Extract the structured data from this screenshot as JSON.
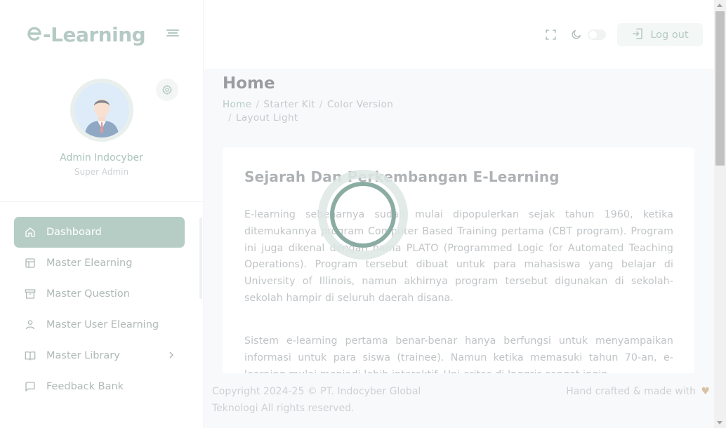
{
  "brand": {
    "logo_text": "-Learning"
  },
  "profile": {
    "name": "Admin Indocyber",
    "role": "Super Admin"
  },
  "sidebar": {
    "items": [
      {
        "label": "Dashboard",
        "icon": "home-icon",
        "active": true
      },
      {
        "label": "Master Elearning",
        "icon": "layout-icon"
      },
      {
        "label": "Master Question",
        "icon": "archive-icon"
      },
      {
        "label": "Master User Elearning",
        "icon": "user-icon"
      },
      {
        "label": "Master Library",
        "icon": "book-icon",
        "has_submenu": true
      },
      {
        "label": "Feedback Bank",
        "icon": "message-icon"
      }
    ]
  },
  "header": {
    "logout_label": "Log out"
  },
  "page": {
    "title": "Home",
    "breadcrumb": [
      "Home",
      "Starter Kit",
      "Color Version",
      "Layout Light"
    ]
  },
  "card": {
    "title": "Sejarah Dan Perkembangan E-Learning",
    "paragraph1": "E-learning sebenarnya sudah mulai dipopulerkan sejak tahun 1960, ketika ditemukannya program Computer Based Training pertama (CBT program). Program ini juga dikenal dengan nama PLATO (Programmed Logic for Automated Teaching Operations). Program tersebut dibuat untuk para mahasiswa yang belajar di University of Illinois, namun akhirnya program tersebut digunakan di sekolah-sekolah hampir di seluruh daerah disana.",
    "paragraph2": "Sistem e-learning pertama benar-benar hanya berfungsi untuk menyampaikan informasi untuk para siswa (trainee). Namun ketika memasuki tahun 70-an, e-learning mulai menjadi lebih interaktif. Uni eritas di Inggris sangat ingin"
  },
  "footer": {
    "copyright": "Copyright 2024-25 © PT. Indocyber Global Teknologi All rights reserved.",
    "credit": "Hand crafted & made with"
  },
  "colors": {
    "accent": "#94b5ab",
    "heart": "#c9a67a"
  }
}
